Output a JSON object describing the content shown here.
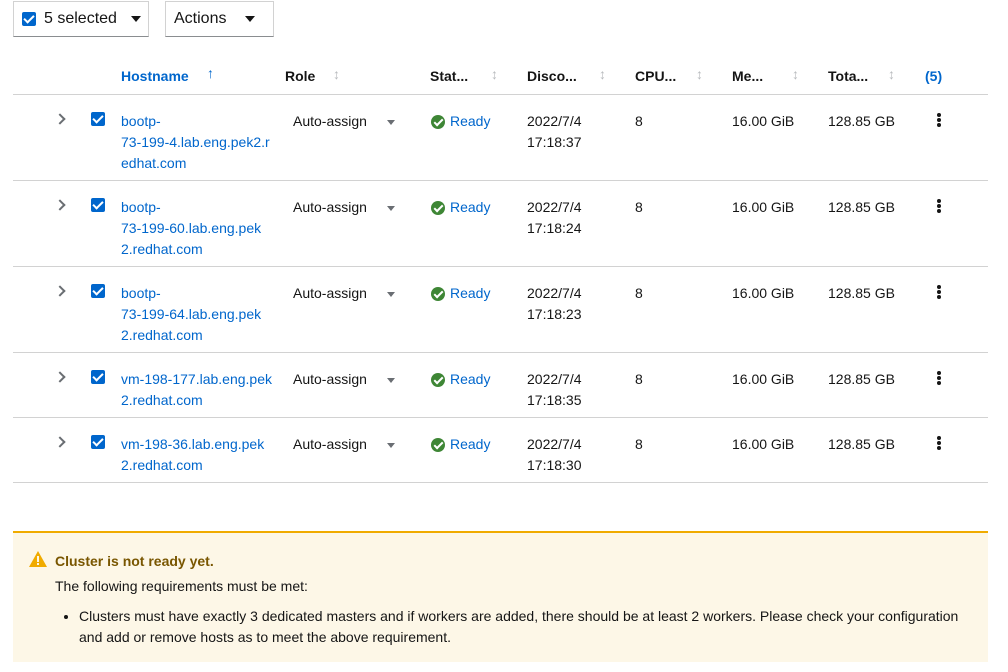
{
  "toolbar": {
    "bulk_select_label": "5 selected",
    "actions_label": "Actions"
  },
  "table": {
    "columns": {
      "hostname": "Hostname",
      "role": "Role",
      "status": "Stat...",
      "discovered": "Disco...",
      "cpu": "CPU...",
      "memory": "Me...",
      "total": "Tota...",
      "count": "(5)"
    },
    "rows": [
      {
        "hostname": "bootp-73-199-4.lab.eng.pek2.redhat.com",
        "hostname_lines": [
          "bootp-",
          "73-199-4.lab.eng.pek2.r",
          "edhat.com"
        ],
        "role": "Auto-assign",
        "status": "Ready",
        "discovered_date": "2022/7/4",
        "discovered_time": "17:18:37",
        "cpu": "8",
        "memory": "16.00 GiB",
        "total": "128.85 GB"
      },
      {
        "hostname": "bootp-73-199-60.lab.eng.pek2.redhat.com",
        "hostname_lines": [
          "bootp-",
          "73-199-60.lab.eng.pek",
          "2.redhat.com"
        ],
        "role": "Auto-assign",
        "status": "Ready",
        "discovered_date": "2022/7/4",
        "discovered_time": "17:18:24",
        "cpu": "8",
        "memory": "16.00 GiB",
        "total": "128.85 GB"
      },
      {
        "hostname": "bootp-73-199-64.lab.eng.pek2.redhat.com",
        "hostname_lines": [
          "bootp-",
          "73-199-64.lab.eng.pek",
          "2.redhat.com"
        ],
        "role": "Auto-assign",
        "status": "Ready",
        "discovered_date": "2022/7/4",
        "discovered_time": "17:18:23",
        "cpu": "8",
        "memory": "16.00 GiB",
        "total": "128.85 GB"
      },
      {
        "hostname": "vm-198-177.lab.eng.pek2.redhat.com",
        "hostname_lines": [
          "vm-198-177.lab.eng.pek",
          "2.redhat.com"
        ],
        "role": "Auto-assign",
        "status": "Ready",
        "discovered_date": "2022/7/4",
        "discovered_time": "17:18:35",
        "cpu": "8",
        "memory": "16.00 GiB",
        "total": "128.85 GB"
      },
      {
        "hostname": "vm-198-36.lab.eng.pek2.redhat.com",
        "hostname_lines": [
          "vm-198-36.lab.eng.pek",
          "2.redhat.com"
        ],
        "role": "Auto-assign",
        "status": "Ready",
        "discovered_date": "2022/7/4",
        "discovered_time": "17:18:30",
        "cpu": "8",
        "memory": "16.00 GiB",
        "total": "128.85 GB"
      }
    ]
  },
  "alert": {
    "title": "Cluster is not ready yet.",
    "description": "The following requirements must be met:",
    "items": [
      "Clusters must have exactly 3 dedicated masters and if workers are added, there should be at least 2 workers. Please check your configuration and add or remove hosts as to meet the above requirement."
    ]
  },
  "colors": {
    "link": "#0066cc",
    "success": "#3e8635",
    "warning": "#f0ab00",
    "warning_bg": "#fdf7e7",
    "warning_title": "#795600"
  },
  "icons": {
    "status_ready": "check-circle-icon",
    "alert": "exclamation-triangle-icon",
    "row_menu": "kebab-icon",
    "expand": "chevron-right-icon",
    "sort": "sort-arrows-icon"
  }
}
